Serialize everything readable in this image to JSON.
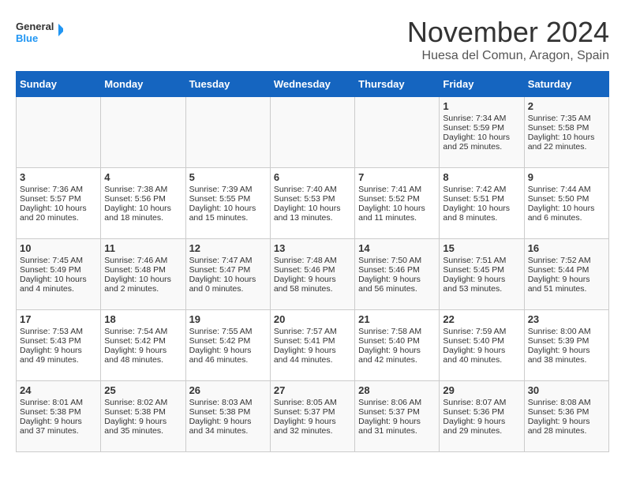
{
  "header": {
    "logo_line1": "General",
    "logo_line2": "Blue",
    "month": "November 2024",
    "location": "Huesa del Comun, Aragon, Spain"
  },
  "weekdays": [
    "Sunday",
    "Monday",
    "Tuesday",
    "Wednesday",
    "Thursday",
    "Friday",
    "Saturday"
  ],
  "weeks": [
    [
      {
        "day": "",
        "info": ""
      },
      {
        "day": "",
        "info": ""
      },
      {
        "day": "",
        "info": ""
      },
      {
        "day": "",
        "info": ""
      },
      {
        "day": "",
        "info": ""
      },
      {
        "day": "1",
        "info": "Sunrise: 7:34 AM\nSunset: 5:59 PM\nDaylight: 10 hours and 25 minutes."
      },
      {
        "day": "2",
        "info": "Sunrise: 7:35 AM\nSunset: 5:58 PM\nDaylight: 10 hours and 22 minutes."
      }
    ],
    [
      {
        "day": "3",
        "info": "Sunrise: 7:36 AM\nSunset: 5:57 PM\nDaylight: 10 hours and 20 minutes."
      },
      {
        "day": "4",
        "info": "Sunrise: 7:38 AM\nSunset: 5:56 PM\nDaylight: 10 hours and 18 minutes."
      },
      {
        "day": "5",
        "info": "Sunrise: 7:39 AM\nSunset: 5:55 PM\nDaylight: 10 hours and 15 minutes."
      },
      {
        "day": "6",
        "info": "Sunrise: 7:40 AM\nSunset: 5:53 PM\nDaylight: 10 hours and 13 minutes."
      },
      {
        "day": "7",
        "info": "Sunrise: 7:41 AM\nSunset: 5:52 PM\nDaylight: 10 hours and 11 minutes."
      },
      {
        "day": "8",
        "info": "Sunrise: 7:42 AM\nSunset: 5:51 PM\nDaylight: 10 hours and 8 minutes."
      },
      {
        "day": "9",
        "info": "Sunrise: 7:44 AM\nSunset: 5:50 PM\nDaylight: 10 hours and 6 minutes."
      }
    ],
    [
      {
        "day": "10",
        "info": "Sunrise: 7:45 AM\nSunset: 5:49 PM\nDaylight: 10 hours and 4 minutes."
      },
      {
        "day": "11",
        "info": "Sunrise: 7:46 AM\nSunset: 5:48 PM\nDaylight: 10 hours and 2 minutes."
      },
      {
        "day": "12",
        "info": "Sunrise: 7:47 AM\nSunset: 5:47 PM\nDaylight: 10 hours and 0 minutes."
      },
      {
        "day": "13",
        "info": "Sunrise: 7:48 AM\nSunset: 5:46 PM\nDaylight: 9 hours and 58 minutes."
      },
      {
        "day": "14",
        "info": "Sunrise: 7:50 AM\nSunset: 5:46 PM\nDaylight: 9 hours and 56 minutes."
      },
      {
        "day": "15",
        "info": "Sunrise: 7:51 AM\nSunset: 5:45 PM\nDaylight: 9 hours and 53 minutes."
      },
      {
        "day": "16",
        "info": "Sunrise: 7:52 AM\nSunset: 5:44 PM\nDaylight: 9 hours and 51 minutes."
      }
    ],
    [
      {
        "day": "17",
        "info": "Sunrise: 7:53 AM\nSunset: 5:43 PM\nDaylight: 9 hours and 49 minutes."
      },
      {
        "day": "18",
        "info": "Sunrise: 7:54 AM\nSunset: 5:42 PM\nDaylight: 9 hours and 48 minutes."
      },
      {
        "day": "19",
        "info": "Sunrise: 7:55 AM\nSunset: 5:42 PM\nDaylight: 9 hours and 46 minutes."
      },
      {
        "day": "20",
        "info": "Sunrise: 7:57 AM\nSunset: 5:41 PM\nDaylight: 9 hours and 44 minutes."
      },
      {
        "day": "21",
        "info": "Sunrise: 7:58 AM\nSunset: 5:40 PM\nDaylight: 9 hours and 42 minutes."
      },
      {
        "day": "22",
        "info": "Sunrise: 7:59 AM\nSunset: 5:40 PM\nDaylight: 9 hours and 40 minutes."
      },
      {
        "day": "23",
        "info": "Sunrise: 8:00 AM\nSunset: 5:39 PM\nDaylight: 9 hours and 38 minutes."
      }
    ],
    [
      {
        "day": "24",
        "info": "Sunrise: 8:01 AM\nSunset: 5:38 PM\nDaylight: 9 hours and 37 minutes."
      },
      {
        "day": "25",
        "info": "Sunrise: 8:02 AM\nSunset: 5:38 PM\nDaylight: 9 hours and 35 minutes."
      },
      {
        "day": "26",
        "info": "Sunrise: 8:03 AM\nSunset: 5:38 PM\nDaylight: 9 hours and 34 minutes."
      },
      {
        "day": "27",
        "info": "Sunrise: 8:05 AM\nSunset: 5:37 PM\nDaylight: 9 hours and 32 minutes."
      },
      {
        "day": "28",
        "info": "Sunrise: 8:06 AM\nSunset: 5:37 PM\nDaylight: 9 hours and 31 minutes."
      },
      {
        "day": "29",
        "info": "Sunrise: 8:07 AM\nSunset: 5:36 PM\nDaylight: 9 hours and 29 minutes."
      },
      {
        "day": "30",
        "info": "Sunrise: 8:08 AM\nSunset: 5:36 PM\nDaylight: 9 hours and 28 minutes."
      }
    ]
  ]
}
